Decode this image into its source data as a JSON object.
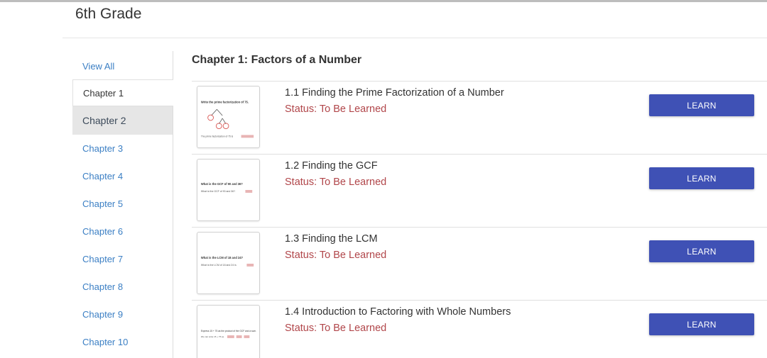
{
  "page": {
    "title": "6th Grade"
  },
  "sidebar": {
    "view_all": "View All",
    "chapters": [
      "Chapter 1",
      "Chapter 2",
      "Chapter 3",
      "Chapter 4",
      "Chapter 5",
      "Chapter 6",
      "Chapter 7",
      "Chapter 8",
      "Chapter 9",
      "Chapter 10"
    ]
  },
  "main": {
    "chapter_title": "Chapter 1: Factors of a Number",
    "learn_label": "LEARN",
    "lessons": [
      {
        "title": "1.1  Finding the Prime Factorization of a Number",
        "status": "Status: To Be Learned",
        "thumb": {
          "heading": "Write the prime factorization of 75.",
          "line": "The prime factorization of 75 is"
        }
      },
      {
        "title": "1.2  Finding the GCF",
        "status": "Status: To Be Learned",
        "thumb": {
          "heading": "What is the GCF of 90 and 36?",
          "line": "What is the GCF of 90 and 36?"
        }
      },
      {
        "title": "1.3  Finding the LCM",
        "status": "Status: To Be Learned",
        "thumb": {
          "heading": "What is the LCM of 18 and 24?",
          "line": "What is the LCM of 18 and 24 is"
        }
      },
      {
        "title": "1.4  Introduction to Factoring with Whole Numbers",
        "status": "Status: To Be Learned",
        "thumb": {
          "heading": "Express 15 + 75 as the product of the GCF and a sum.",
          "line": "We can write 15 + 75 as"
        }
      }
    ]
  },
  "colors": {
    "accent": "#3f51b5",
    "status": "#b1464a",
    "link": "#3b7fc4"
  }
}
